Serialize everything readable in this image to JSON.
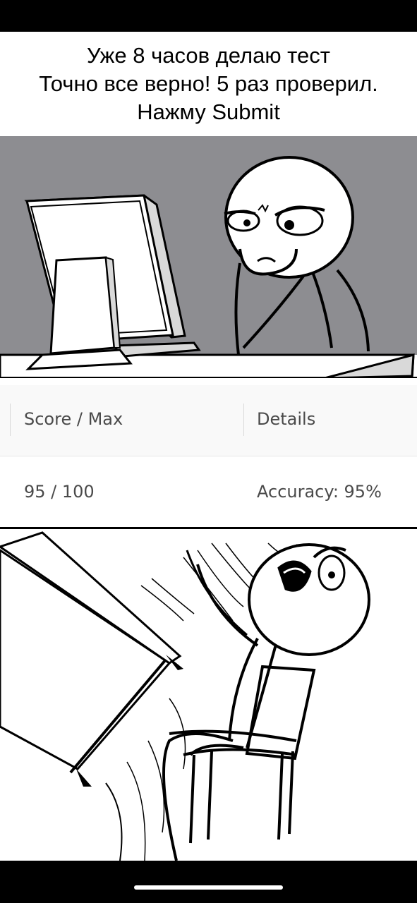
{
  "caption": {
    "line1": "Уже 8 часов делаю тест",
    "line2": "Точно все верно! 5 раз проверил.",
    "line3": "Нажму Submit"
  },
  "results_table": {
    "headers": [
      "Score / Max",
      "Details"
    ],
    "row": [
      "95 / 100",
      "Accuracy: 95%"
    ]
  },
  "colors": {
    "background_gray": "#8d8d91",
    "ink": "#000000",
    "paper": "#ffffff",
    "monitor_shade": "#d9d9d9"
  }
}
